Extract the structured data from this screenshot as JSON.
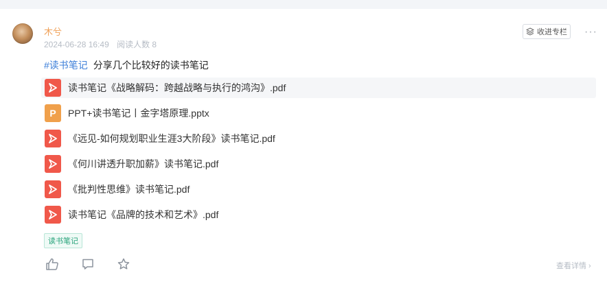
{
  "post": {
    "author": "木兮",
    "date": "2024-06-28 16:49",
    "reads": "阅读人数 8",
    "hashtag": "#读书笔记",
    "title": "分享几个比较好的读书笔记",
    "tag": "读书笔记",
    "detail_link": "查看详情 ›"
  },
  "header": {
    "fav_label": "收进专栏",
    "more_label": "···"
  },
  "files": [
    {
      "name": "读书笔记《战略解码：跨越战略与执行的鸿沟》.pdf",
      "type": "pdf"
    },
    {
      "name": "PPT+读书笔记丨金字塔原理.pptx",
      "type": "pptx"
    },
    {
      "name": "《远见-如何规划职业生涯3大阶段》读书笔记.pdf",
      "type": "pdf"
    },
    {
      "name": "《何川讲透升职加薪》读书笔记.pdf",
      "type": "pdf"
    },
    {
      "name": "《批判性思维》读书笔记.pdf",
      "type": "pdf"
    },
    {
      "name": "读书笔记《品牌的技术和艺术》.pdf",
      "type": "pdf"
    }
  ],
  "icons": {
    "pdf": "pdf-file-icon",
    "pptx": "pptx-file-icon",
    "like": "thumb-up-icon",
    "comment": "comment-icon",
    "star": "star-icon"
  },
  "colors": {
    "author": "#f0a25a",
    "hashtag": "#3d7fd9",
    "pdf": "#f0584a",
    "pptx": "#f0a04b",
    "tag": "#27a37a"
  }
}
